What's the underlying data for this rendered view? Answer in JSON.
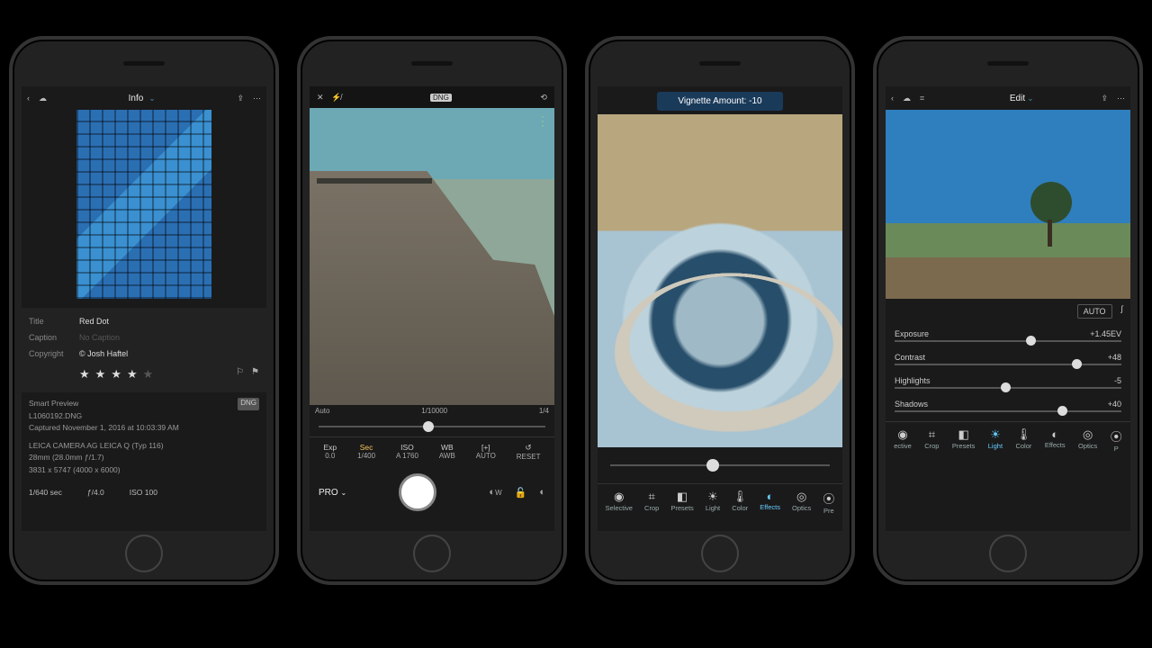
{
  "screen1": {
    "title": "Info",
    "metadata": {
      "title_label": "Title",
      "title_value": "Red Dot",
      "caption_label": "Caption",
      "caption_placeholder": "No Caption",
      "copyright_label": "Copyright",
      "copyright_value": "© Josh Haftel"
    },
    "rating": 4,
    "exif": {
      "preview": "Smart Preview",
      "badge": "DNG",
      "filename": "L1060192.DNG",
      "captured": "Captured November 1, 2016 at 10:03:39 AM",
      "camera": "LEICA CAMERA AG LEICA Q (Typ 116)",
      "lens": "28mm (28.0mm ƒ/1.7)",
      "dimensions": "3831 x 5747 (4000 x 6000)",
      "shutter": "1/640 sec",
      "aperture": "ƒ/4.0",
      "iso": "ISO 100"
    }
  },
  "screen2": {
    "badge": "DNG",
    "scale": {
      "left": "Auto",
      "mid": "1/10000",
      "right": "1/4"
    },
    "controls": [
      {
        "name": "Exp",
        "val": "0.0"
      },
      {
        "name": "Sec",
        "val": "1/400"
      },
      {
        "name": "ISO",
        "val": "A 1760"
      },
      {
        "name": "WB",
        "val": "AWB"
      },
      {
        "name": "[+]",
        "val": "AUTO"
      },
      {
        "name": "↺",
        "val": "RESET"
      }
    ],
    "pro": "PRO",
    "wb_label": "W"
  },
  "screen3": {
    "banner": "Vignette Amount: -10",
    "tools": [
      {
        "name": "Selective",
        "icon": "◉"
      },
      {
        "name": "Crop",
        "icon": "⌗"
      },
      {
        "name": "Presets",
        "icon": "◧"
      },
      {
        "name": "Light",
        "icon": "☀"
      },
      {
        "name": "Color",
        "icon": "🌡"
      },
      {
        "name": "Effects",
        "icon": "◐"
      },
      {
        "name": "Optics",
        "icon": "◎"
      },
      {
        "name": "Pre",
        "icon": "⦿"
      }
    ],
    "selected": "Effects"
  },
  "screen4": {
    "title": "Edit",
    "auto": "AUTO",
    "sliders": [
      {
        "name": "Exposure",
        "value": "+1.45EV",
        "pos": 58
      },
      {
        "name": "Contrast",
        "value": "+48",
        "pos": 78
      },
      {
        "name": "Highlights",
        "value": "-5",
        "pos": 47
      },
      {
        "name": "Shadows",
        "value": "+40",
        "pos": 72
      }
    ],
    "tools": [
      {
        "name": "ective",
        "icon": "◉"
      },
      {
        "name": "Crop",
        "icon": "⌗"
      },
      {
        "name": "Presets",
        "icon": "◧"
      },
      {
        "name": "Light",
        "icon": "☀"
      },
      {
        "name": "Color",
        "icon": "🌡"
      },
      {
        "name": "Effects",
        "icon": "◐"
      },
      {
        "name": "Optics",
        "icon": "◎"
      },
      {
        "name": "P",
        "icon": "⦿"
      }
    ],
    "selected": "Light"
  }
}
